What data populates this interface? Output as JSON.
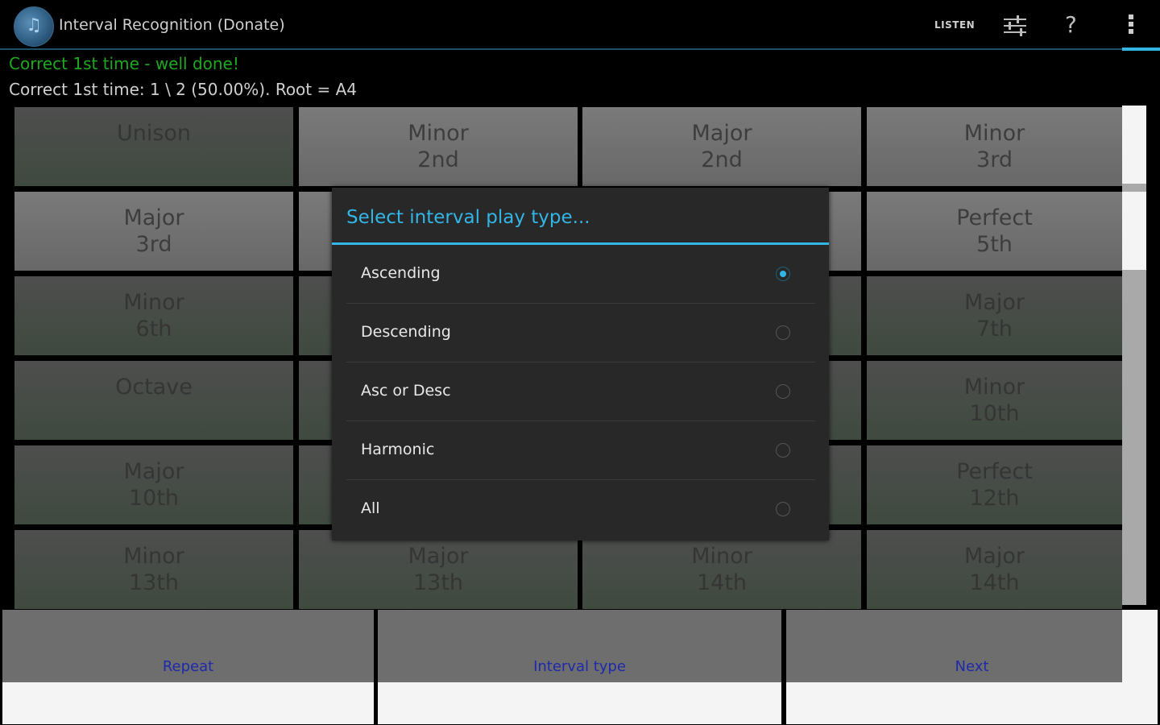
{
  "actionbar": {
    "title": "Interval Recognition (Donate)",
    "listen_label": "LISTEN",
    "icons": [
      "music-note-icon",
      "sliders-icon",
      "help-icon",
      "overflow-menu-icon"
    ],
    "accent": "#33b5e5"
  },
  "status": {
    "line1": "Correct 1st time - well done!",
    "line1_color": "#1fa81f",
    "line2": "Correct 1st time: 1 \\ 2 (50.00%).  Root = A4"
  },
  "grid": {
    "cells": [
      [
        "Unison",
        ""
      ],
      [
        "Minor",
        "2nd"
      ],
      [
        "Major",
        "2nd"
      ],
      [
        "Minor",
        "3rd"
      ],
      [
        "Major",
        "3rd"
      ],
      [
        "",
        ""
      ],
      [
        "",
        ""
      ],
      [
        "Perfect",
        "5th"
      ],
      [
        "Minor",
        "6th"
      ],
      [
        "",
        ""
      ],
      [
        "",
        ""
      ],
      [
        "Major",
        "7th"
      ],
      [
        "Octave",
        ""
      ],
      [
        "",
        ""
      ],
      [
        "",
        ""
      ],
      [
        "Minor",
        "10th"
      ],
      [
        "Major",
        "10th"
      ],
      [
        "",
        ""
      ],
      [
        "",
        ""
      ],
      [
        "Perfect",
        "12th"
      ],
      [
        "Minor",
        "13th"
      ],
      [
        "Major",
        "13th"
      ],
      [
        "Minor",
        "14th"
      ],
      [
        "Major",
        "14th"
      ]
    ]
  },
  "bottom": {
    "repeat": "Repeat",
    "interval_type": "Interval type",
    "next": "Next",
    "label_color": "#1e2aa8"
  },
  "dialog": {
    "title": "Select interval play type...",
    "options": [
      {
        "label": "Ascending",
        "selected": true
      },
      {
        "label": "Descending",
        "selected": false
      },
      {
        "label": "Asc or Desc",
        "selected": false
      },
      {
        "label": "Harmonic",
        "selected": false
      },
      {
        "label": "All",
        "selected": false
      }
    ]
  }
}
